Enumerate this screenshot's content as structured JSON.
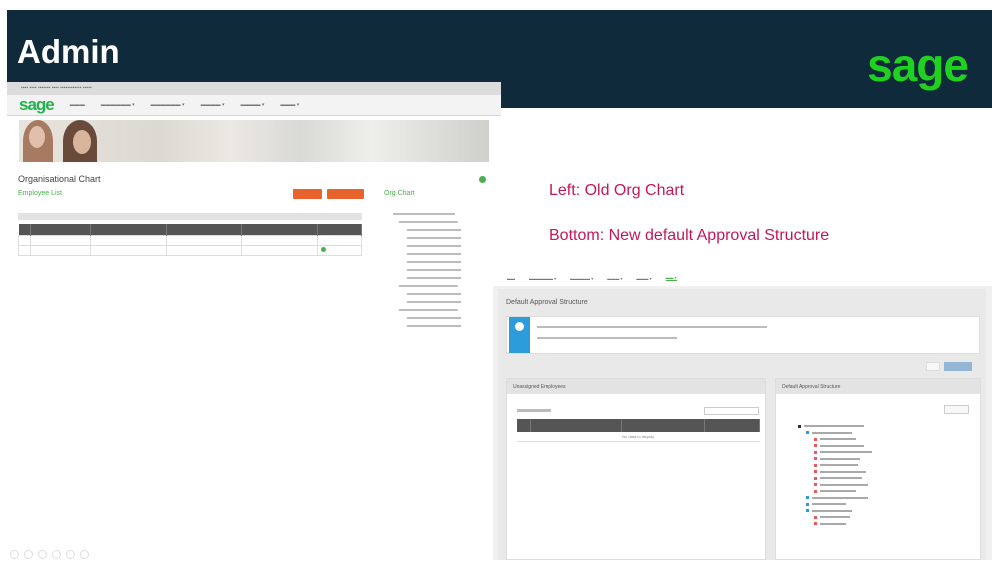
{
  "slide": {
    "title": "Admin",
    "logo_text": "sage",
    "captions": {
      "left": "Left: Old Org Chart",
      "bottom": "Bottom: New default Approval Structure"
    }
  },
  "colors": {
    "header_band": "#0f2a3a",
    "logo_green": "#1fd21f",
    "caption": "#c2185b",
    "old_accent_green": "#4ab04a",
    "old_button_orange": "#e8622c",
    "info_badge_blue": "#2d9cdb"
  },
  "old_org_chart_screenshot": {
    "logo_text": "sage",
    "page_title": "Organisational Chart",
    "list_label": "Employee List",
    "org_chart_label": "Org Chart"
  },
  "new_approval_screenshot": {
    "page_title": "Default Approval Structure",
    "left_panel_title": "Unassigned Employees",
    "right_panel_title": "Default Approval Structure",
    "active_nav_item": "Admin",
    "empty_table_text": "No data to display"
  },
  "icons": {
    "info_badge": "info-icon",
    "footer": [
      "previous-icon",
      "next-icon",
      "zoom-icon",
      "menu-icon",
      "pen-icon",
      "more-icon"
    ]
  }
}
